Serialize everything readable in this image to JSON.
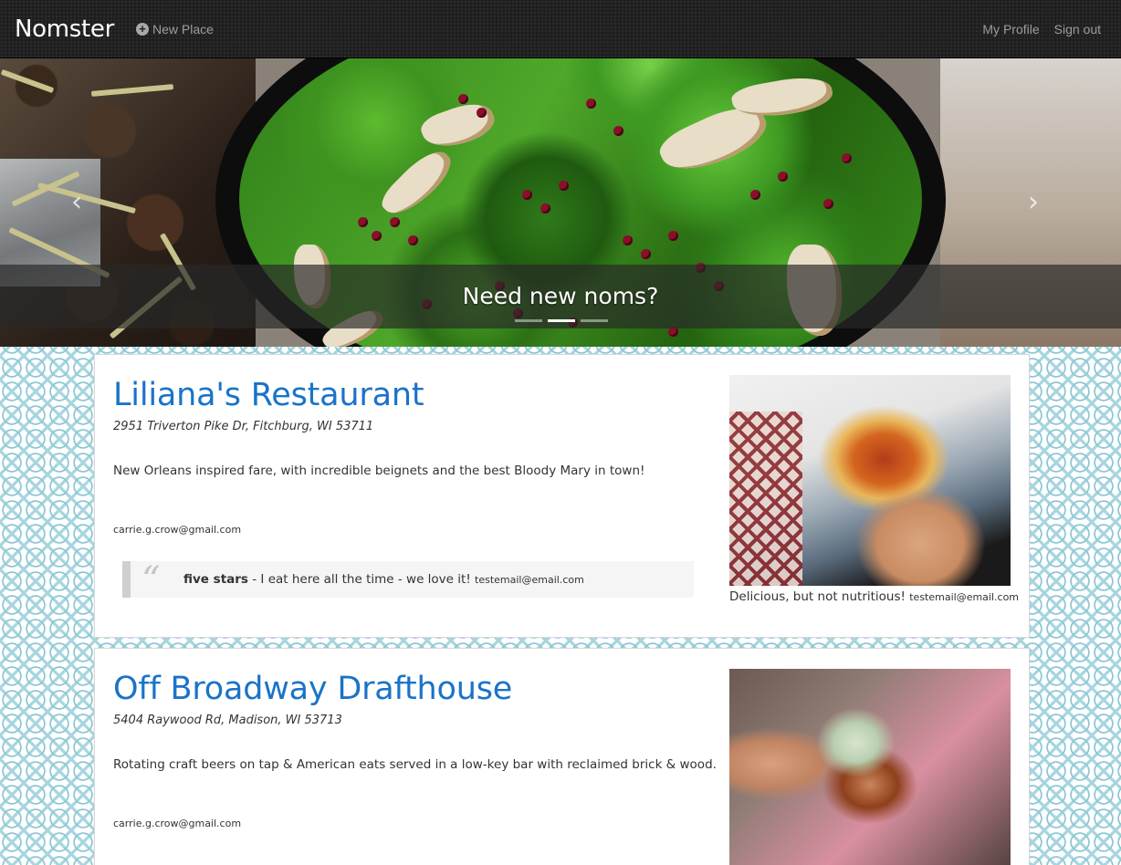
{
  "navbar": {
    "brand": "Nomster",
    "new_place": "New Place",
    "my_profile": "My Profile",
    "sign_out": "Sign out"
  },
  "hero": {
    "caption": "Need new noms?",
    "slide_count": 3,
    "active_slide": 2
  },
  "places": [
    {
      "name": "Liliana's Restaurant",
      "address": "2951 Triverton Pike Dr, Fitchburg, WI 53711",
      "description": "New Orleans inspired fare, with incredible beignets and the best Bloody Mary in town!",
      "email": "carrie.g.crow@gmail.com",
      "review": {
        "title": "five stars",
        "text": " - I eat here all the time - we love it! ",
        "email": "testemail@email.com"
      },
      "photo_caption": {
        "text": "Delicious, but not nutritious! ",
        "email": "testemail@email.com"
      }
    },
    {
      "name": "Off Broadway Drafthouse",
      "address": "5404 Raywood Rd, Madison, WI 53713",
      "description": "Rotating craft beers on tap & American eats served in a low-key bar with reclaimed brick & wood.",
      "email": "carrie.g.crow@gmail.com"
    }
  ],
  "icons": {
    "new_place": "plus-circle-icon",
    "carousel_prev": "chevron-left-icon",
    "carousel_next": "chevron-right-icon",
    "quote": "quote-icon"
  },
  "colors": {
    "navbar_bg": "#1e1e1e",
    "nav_link": "#9d9d9d",
    "place_name": "#1a73c9",
    "pattern": "#8cc7d4"
  }
}
